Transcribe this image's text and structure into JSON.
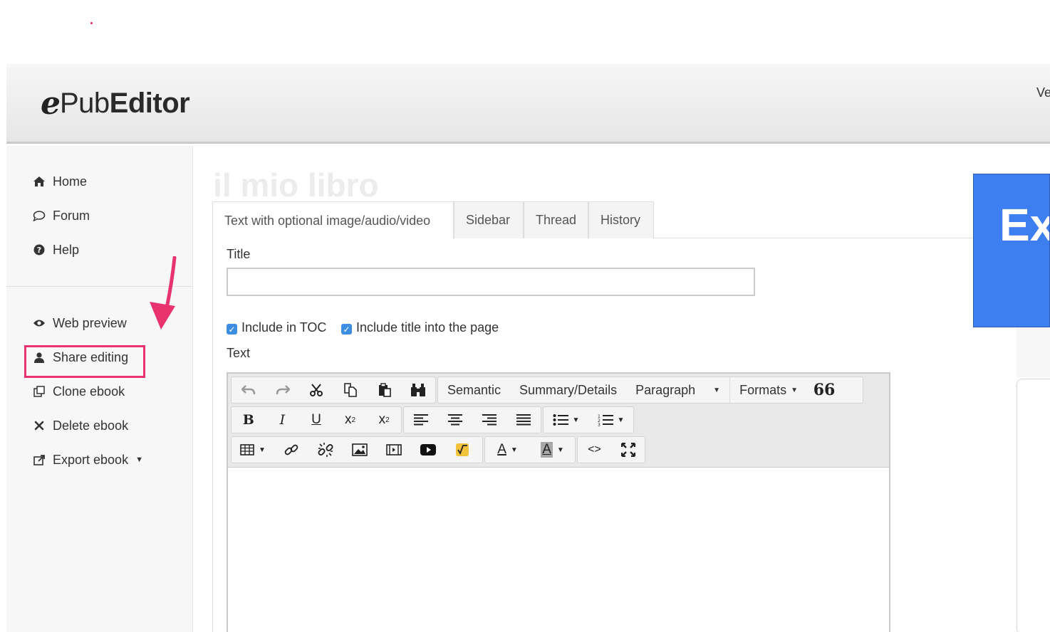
{
  "header": {
    "logo_mark": "e",
    "logo_light": "Pub",
    "logo_bold": "Editor",
    "right_text": "Ve"
  },
  "sidebar": {
    "items": [
      {
        "label": "Home",
        "icon": "home-icon"
      },
      {
        "label": "Forum",
        "icon": "comment-icon"
      },
      {
        "label": "Help",
        "icon": "question-icon"
      },
      {
        "label": "Web preview",
        "icon": "eye-icon"
      },
      {
        "label": "Share editing",
        "icon": "user-icon"
      },
      {
        "label": "Clone ebook",
        "icon": "clone-icon"
      },
      {
        "label": "Delete ebook",
        "icon": "close-icon"
      },
      {
        "label": "Export ebook",
        "icon": "export-icon"
      }
    ],
    "highlight_color": "#e8336e"
  },
  "main": {
    "book_title": "il mio libro",
    "tabs": [
      {
        "label": "Text with optional image/audio/video",
        "active": true
      },
      {
        "label": "Sidebar",
        "active": false
      },
      {
        "label": "Thread",
        "active": false
      },
      {
        "label": "History",
        "active": false
      }
    ],
    "title_label": "Title",
    "title_value": "",
    "include_toc": "Include in TOC",
    "include_title": "Include title into the page",
    "text_label": "Text"
  },
  "toolbar": {
    "semantic": "Semantic",
    "summary": "Summary/Details",
    "paragraph": "Paragraph",
    "formats": "Formats",
    "bold": "B",
    "italic": "I",
    "underline": "U",
    "text_color": "A",
    "bg_color": "A",
    "code": "<>",
    "quote": "66"
  },
  "right_panel": {
    "text": "Ex",
    "color": "#3d7ef0"
  }
}
